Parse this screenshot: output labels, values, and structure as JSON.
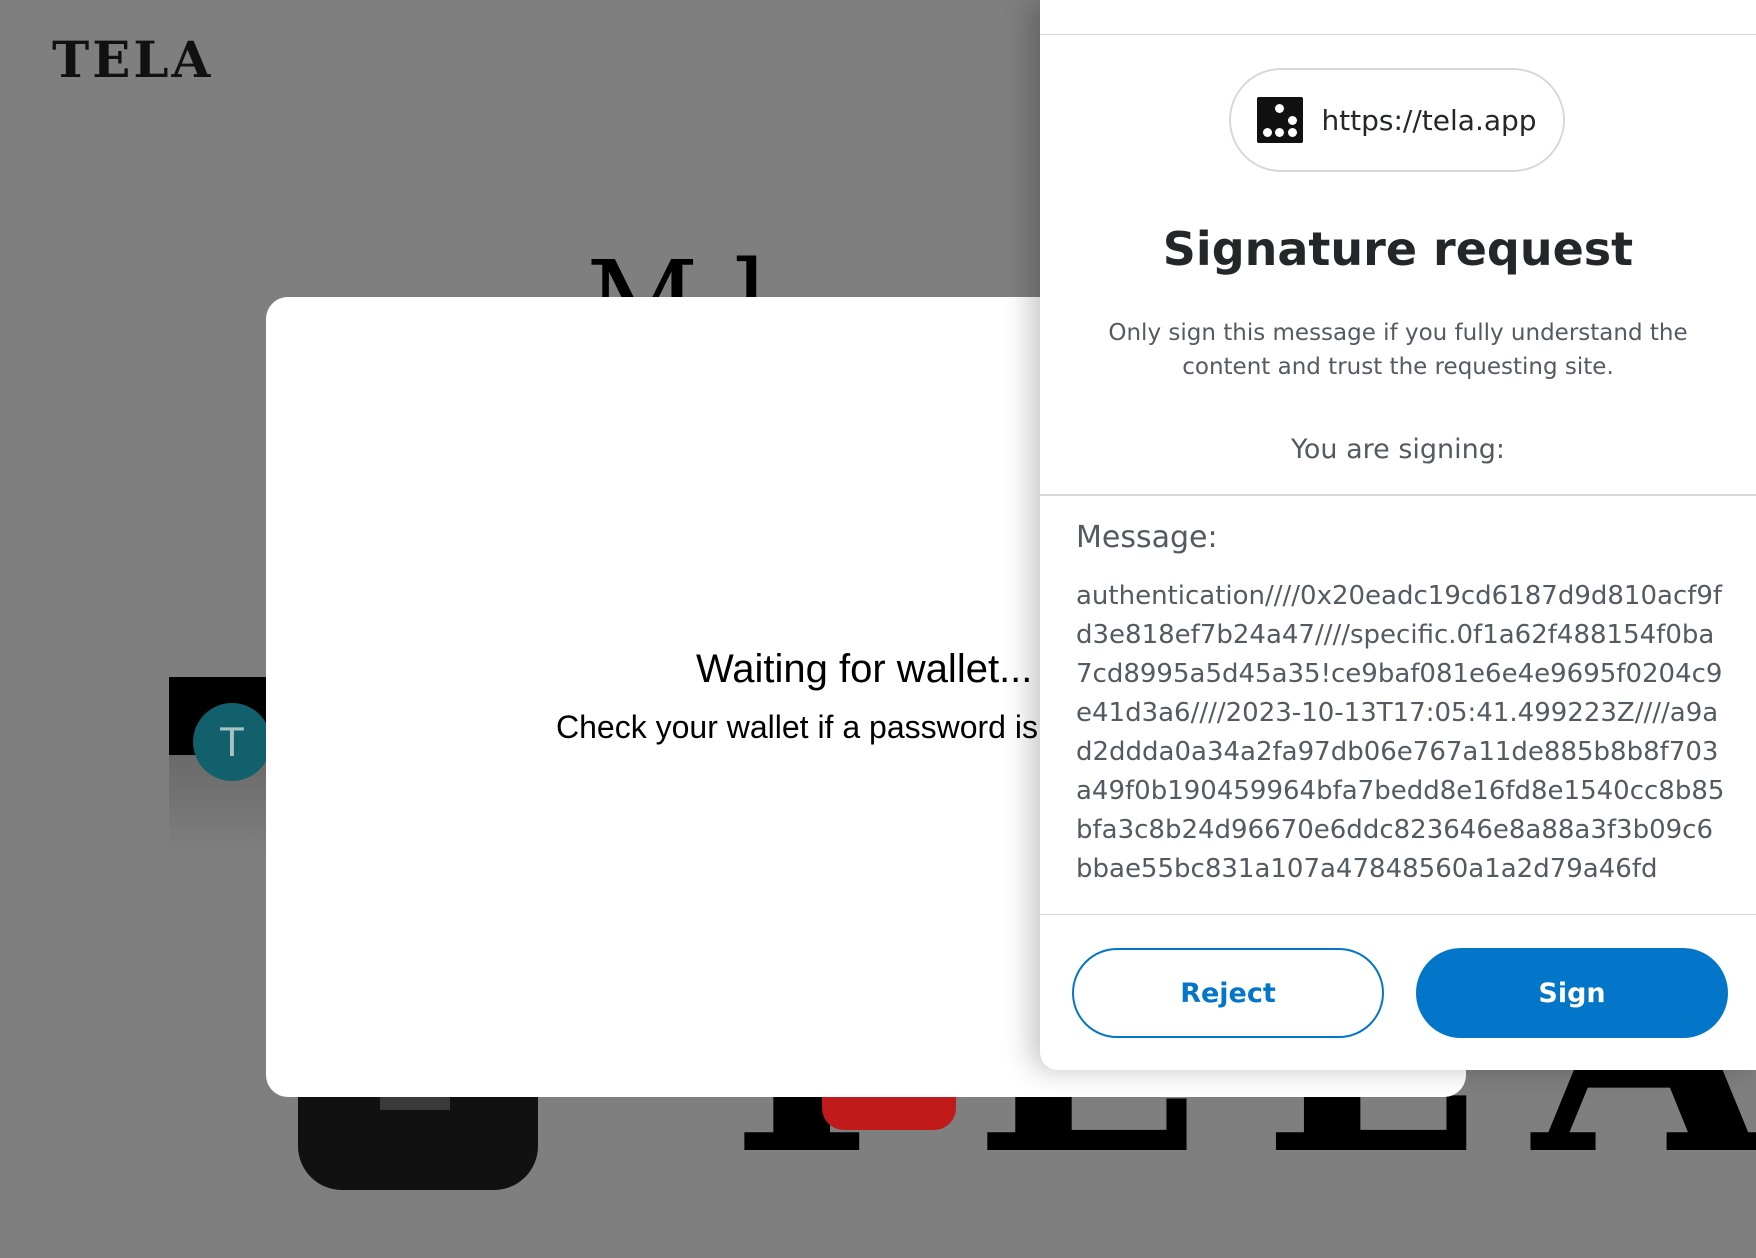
{
  "background_page": {
    "logo": "TELA",
    "heading_fragment": "M  l",
    "avatar_initial": "T",
    "wordmark": "TELA"
  },
  "wait_modal": {
    "title": "Waiting for wallet...",
    "subtitle": "Check your wallet if a password is"
  },
  "wallet": {
    "origin": {
      "icon": "tela-site-icon",
      "url": "https://tela.app"
    },
    "title": "Signature request",
    "warning": "Only sign this message if you fully understand the content and trust the requesting site.",
    "signing_label": "You are signing:",
    "message_label": "Message:",
    "message": "authentication////0x20eadc19cd6187d9d810acf9fd3e818ef7b24a47////specific.0f1a62f488154f0ba7cd8995a5d45a35!ce9baf081e6e4e9695f0204c9e41d3a6////2023-10-13T17:05:41.499223Z////a9ad2ddda0a34a2fa97db06e767a11de885b8b8f703a49f0b190459964bfa7bedd8e16fd8e1540cc8b85bfa3c8b24d96670e6ddc823646e8a88a3f3b09c6bbae55bc831a107a47848560a1a2d79a46fd",
    "buttons": {
      "reject": "Reject",
      "sign": "Sign"
    },
    "colors": {
      "accent": "#0376c9",
      "text": "#24272a",
      "muted": "#535a61",
      "border": "#d6d9dc"
    }
  }
}
